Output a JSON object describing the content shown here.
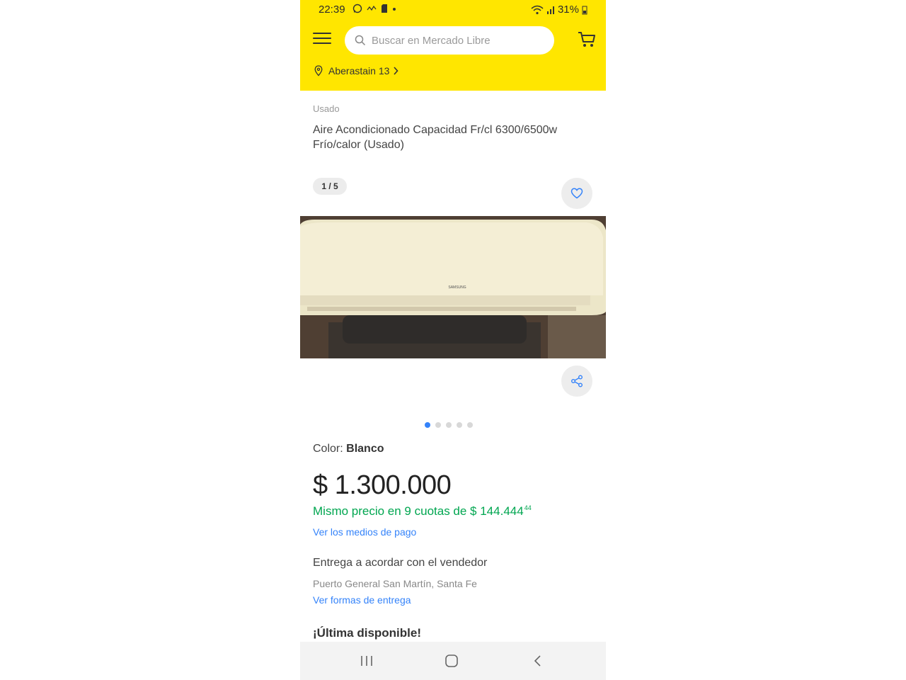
{
  "status_bar": {
    "time": "22:39",
    "battery": "31%"
  },
  "header": {
    "search_placeholder": "Buscar en Mercado Libre",
    "address": "Aberastain 13",
    "accent_color": "#ffe600"
  },
  "product": {
    "condition": "Usado",
    "title": "Aire Acondicionado Capacidad Fr/cl 6300/6500w Frío/calor (Usado)",
    "image_counter": "1 / 5",
    "image_brand_text": "SAMSUNG",
    "total_images": 5,
    "active_image_index": 0,
    "color_label": "Color:",
    "color_value": "Blanco",
    "price": "$ 1.300.000",
    "installments_text": "Mismo precio en 9 cuotas de $ 144.444",
    "installments_cents": "44",
    "payment_link": "Ver los medios de pago",
    "delivery_title": "Entrega a acordar con el vendedor",
    "delivery_location": "Puerto General San Martín, Santa Fe",
    "delivery_link": "Ver formas de entrega",
    "stock_text": "¡Última disponible!"
  },
  "icons": {
    "menu": "hamburger-icon",
    "search": "search-icon",
    "cart": "cart-icon",
    "location": "location-pin-icon",
    "favorite": "heart-icon",
    "share": "share-icon"
  }
}
